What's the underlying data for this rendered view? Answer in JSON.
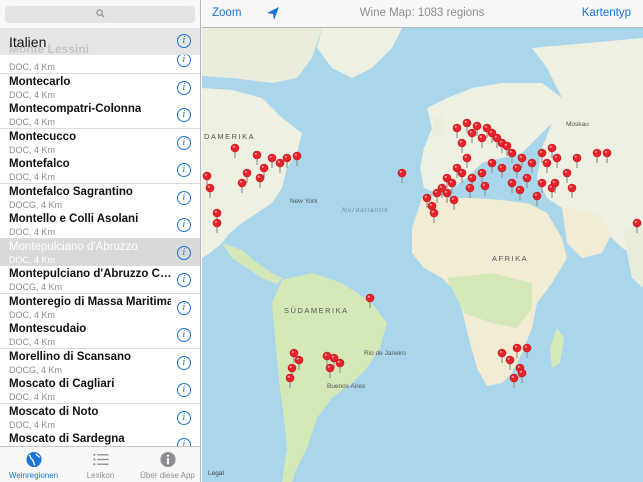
{
  "search": {
    "icon": "magnifier-icon"
  },
  "list": {
    "section_title": "Italien",
    "section_ghost": "Monte Lessini",
    "items": [
      {
        "name": "",
        "sub": "DOC, 4 Km"
      },
      {
        "name": "Montecarlo",
        "sub": "DOC, 4 Km"
      },
      {
        "name": "Montecompatri-Colonna",
        "sub": "DOC, 4 Km"
      },
      {
        "name": "Montecucco",
        "sub": "DOC, 4 Km"
      },
      {
        "name": "Montefalco",
        "sub": "DOC, 4 Km"
      },
      {
        "name": "Montefalco Sagrantino",
        "sub": "DOCG, 4 Km"
      },
      {
        "name": "Montello e Colli Asolani",
        "sub": "DOC, 4 Km"
      },
      {
        "name": "Montepulciano d'Abruzzo",
        "sub": "DOC, 4 Km",
        "selected": true
      },
      {
        "name": "Montepulciano d'Abruzzo C…",
        "sub": "DOCG, 4 Km"
      },
      {
        "name": "Monteregio di Massa Maritima",
        "sub": "DOC, 4 Km"
      },
      {
        "name": "Montescudaio",
        "sub": "DOC, 4 Km"
      },
      {
        "name": "Morellino di Scansano",
        "sub": "DOCG, 4 Km"
      },
      {
        "name": "Moscato di Cagliari",
        "sub": "DOC, 4 Km"
      },
      {
        "name": "Moscato di Noto",
        "sub": "DOC, 4 Km"
      },
      {
        "name": "Moscato di Sardegna",
        "sub": "DOC, 4 Km"
      }
    ]
  },
  "tabs": [
    {
      "label": "Weinregionen",
      "icon": "globe-icon",
      "active": true
    },
    {
      "label": "Lexikon",
      "icon": "list-icon",
      "active": false
    },
    {
      "label": "Über diese App",
      "icon": "info-icon",
      "active": false
    }
  ],
  "navbar": {
    "zoom_label": "Zoom",
    "title": "Wine Map: 1083 regions",
    "maptype_label": "Kartentyp"
  },
  "map": {
    "labels": {
      "north_america": "DAMERIKA",
      "europe_city": "Moskau",
      "new_york": "New York",
      "atlantic": "Nordatlantik",
      "africa": "AFRIKA",
      "south_america": "SÜDAMERIKA",
      "rio": "Rio de Janeiro",
      "buenos_aires": "Buenos Aires"
    },
    "legal": "Legal",
    "colors": {
      "water": "#a9d6ea",
      "land": "#eef0e2",
      "green": "#d5e8b8",
      "desert": "#f2ecd4",
      "pin": "#e8232a"
    }
  }
}
